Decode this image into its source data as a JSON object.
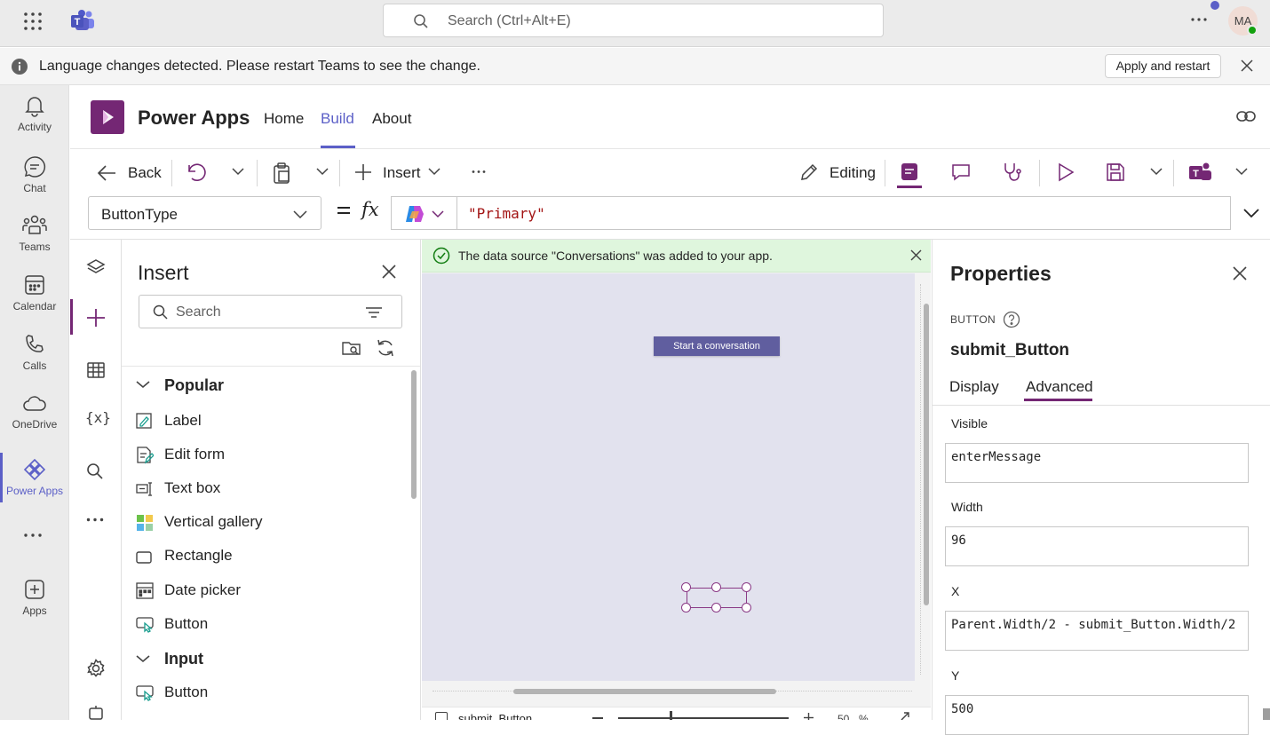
{
  "search": {
    "placeholder": "Search (Ctrl+Alt+E)"
  },
  "avatar": {
    "initials": "MA"
  },
  "notice": {
    "text": "Language changes detected. Please restart Teams to see the change.",
    "apply_label": "Apply and restart"
  },
  "rail": {
    "items": [
      {
        "label": "Activity"
      },
      {
        "label": "Chat"
      },
      {
        "label": "Teams"
      },
      {
        "label": "Calendar"
      },
      {
        "label": "Calls"
      },
      {
        "label": "OneDrive"
      },
      {
        "label": "Power Apps"
      },
      {
        "label": "Apps"
      }
    ]
  },
  "app": {
    "title": "Power Apps",
    "tabs": [
      "Home",
      "Build",
      "About"
    ],
    "active_tab": "Build"
  },
  "toolbar": {
    "back": "Back",
    "insert": "Insert",
    "editing": "Editing"
  },
  "formula": {
    "property": "ButtonType",
    "value": "\"Primary\""
  },
  "insert_pane": {
    "title": "Insert",
    "search_placeholder": "Search",
    "popular_header": "Popular",
    "popular_items": [
      "Label",
      "Edit form",
      "Text box",
      "Vertical gallery",
      "Rectangle",
      "Date picker",
      "Button"
    ],
    "input_header": "Input",
    "input_items": [
      "Button"
    ]
  },
  "canvas": {
    "banner": "The data source \"Conversations\" was added to your app.",
    "start_button": "Start a conversation",
    "status_control": "submit_Button",
    "zoom": "50",
    "zoom_unit": "%"
  },
  "properties": {
    "title": "Properties",
    "type": "BUTTON",
    "name": "submit_Button",
    "tabs": [
      "Display",
      "Advanced"
    ],
    "active_tab": "Advanced",
    "fields": [
      {
        "label": "Visible",
        "value": "enterMessage"
      },
      {
        "label": "Width",
        "value": "96"
      },
      {
        "label": "X",
        "value": "Parent.Width/2 - submit_Button.Width/2"
      },
      {
        "label": "Y",
        "value": "500"
      }
    ]
  },
  "colors": {
    "accent": "#5b5fc7",
    "powerapps": "#742774",
    "banner": "#dff6dd",
    "canvas": "#e2e2ee",
    "start_button": "#605e9f"
  }
}
